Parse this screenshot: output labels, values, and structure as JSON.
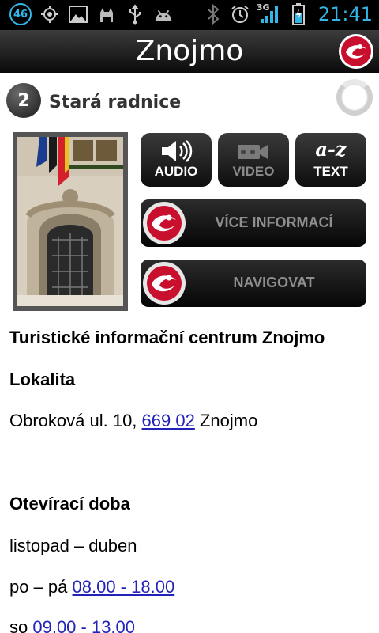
{
  "status_bar": {
    "notification_count": "46",
    "network": "3G",
    "time": "21:41",
    "left_icons": [
      "gps-icon",
      "image-icon",
      "cat-icon",
      "usb-icon",
      "android-icon"
    ],
    "right_icons": [
      "bluetooth-icon",
      "alarm-icon",
      "signal-icon",
      "battery-icon"
    ]
  },
  "header": {
    "title": "Znojmo"
  },
  "poi": {
    "number": "2",
    "name": "Stará radnice"
  },
  "media_buttons": {
    "audio": "AUDIO",
    "video": "VIDEO",
    "text_icon": "a-z",
    "text": "TEXT"
  },
  "actions": {
    "more_info": "VÍCE INFORMACÍ",
    "navigate": "NAVIGOVAT"
  },
  "content": {
    "heading": "Turistické informační centrum Znojmo",
    "locality_label": "Lokalita",
    "address_prefix": "Obroková ul. 10, ",
    "address_postcode": "669 02",
    "address_suffix": " Znojmo",
    "hours_label": "Otevírací doba",
    "season": "listopad – duben",
    "weekday_prefix": "po – pá ",
    "weekday_hours": "08.00 - 18.00",
    "saturday_prefix": "so ",
    "saturday_hours": "09.00 - 13.00"
  },
  "colors": {
    "accent": "#33b5e5",
    "logo_red": "#c8102e",
    "link": "#2222bb"
  }
}
